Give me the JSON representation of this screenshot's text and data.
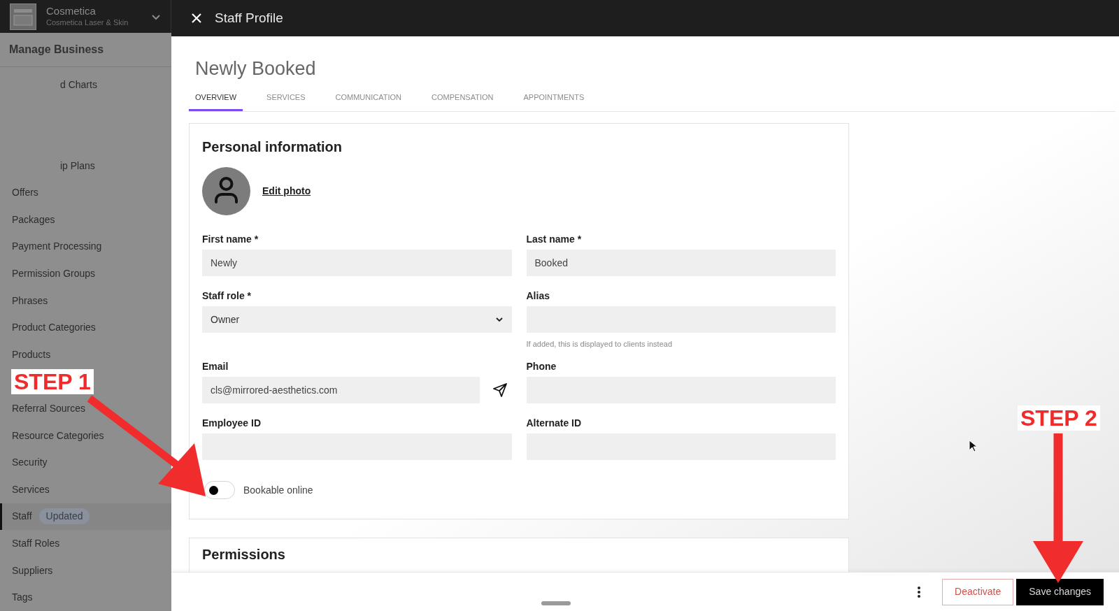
{
  "business": {
    "name": "Cosmetica",
    "location": "Cosmetica Laser & Skin"
  },
  "sidebar": {
    "title": "Manage Business",
    "items": [
      {
        "kind": "partial",
        "label": "d Charts"
      },
      {
        "kind": "covered"
      },
      {
        "kind": "covered"
      },
      {
        "kind": "partial",
        "label": "ip Plans"
      },
      {
        "kind": "item",
        "label": "Offers",
        "selected": false
      },
      {
        "kind": "item",
        "label": "Packages",
        "selected": false
      },
      {
        "kind": "item",
        "label": "Payment Processing",
        "selected": false
      },
      {
        "kind": "item",
        "label": "Permission Groups",
        "selected": false
      },
      {
        "kind": "item",
        "label": "Phrases",
        "selected": false
      },
      {
        "kind": "item",
        "label": "Product Categories",
        "selected": false
      },
      {
        "kind": "item",
        "label": "Products",
        "selected": false
      },
      {
        "kind": "covered"
      },
      {
        "kind": "item",
        "label": "Referral Sources",
        "selected": false
      },
      {
        "kind": "item",
        "label": "Resource Categories",
        "selected": false
      },
      {
        "kind": "item",
        "label": "Security",
        "selected": false
      },
      {
        "kind": "item",
        "label": "Services",
        "selected": false
      },
      {
        "kind": "item",
        "label": "Staff",
        "badge": "Updated",
        "selected": true
      },
      {
        "kind": "item",
        "label": "Staff Roles",
        "selected": false
      },
      {
        "kind": "item",
        "label": "Suppliers",
        "selected": false
      },
      {
        "kind": "item",
        "label": "Tags",
        "selected": false
      }
    ]
  },
  "window": {
    "title": "Staff Profile"
  },
  "profile": {
    "name": "Newly Booked"
  },
  "tabs": [
    {
      "label": "OVERVIEW",
      "selected": true
    },
    {
      "label": "SERVICES",
      "selected": false
    },
    {
      "label": "COMMUNICATION",
      "selected": false
    },
    {
      "label": "COMPENSATION",
      "selected": false
    },
    {
      "label": "APPOINTMENTS",
      "selected": false
    }
  ],
  "personal_information": {
    "title": "Personal information",
    "edit_photo": "Edit photo",
    "fields": [
      {
        "kind": "text",
        "label": "First name *",
        "value": "Newly"
      },
      {
        "kind": "text",
        "label": "Last name *",
        "value": "Booked"
      },
      {
        "kind": "select",
        "label": "Staff role *",
        "value": "Owner"
      },
      {
        "kind": "text",
        "label": "Alias",
        "hint": "If added, this is displayed to clients instead"
      },
      {
        "kind": "email",
        "label": "Email",
        "value": "cls@mirrored-aesthetics.com"
      },
      {
        "kind": "text",
        "label": "Phone"
      },
      {
        "kind": "text",
        "label": "Employee ID"
      },
      {
        "kind": "text",
        "label": "Alternate ID"
      }
    ],
    "bookable_online": {
      "label": "Bookable online",
      "on": false
    }
  },
  "permissions": {
    "title": "Permissions"
  },
  "footer": {
    "buttons": [
      {
        "kind": "secondary",
        "label": "Deactivate"
      },
      {
        "kind": "primary",
        "label": "Save changes"
      }
    ]
  },
  "annotations": [
    {
      "text": "STEP 1"
    },
    {
      "text": "STEP 2"
    }
  ]
}
